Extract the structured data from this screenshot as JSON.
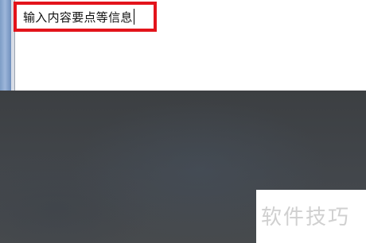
{
  "editor": {
    "text": "输入内容要点等信息"
  },
  "watermark": {
    "text": "软件技巧"
  },
  "colors": {
    "highlight": "#e3141b",
    "window_frame": "#7d9dc6",
    "backdrop": "#3f4347"
  }
}
